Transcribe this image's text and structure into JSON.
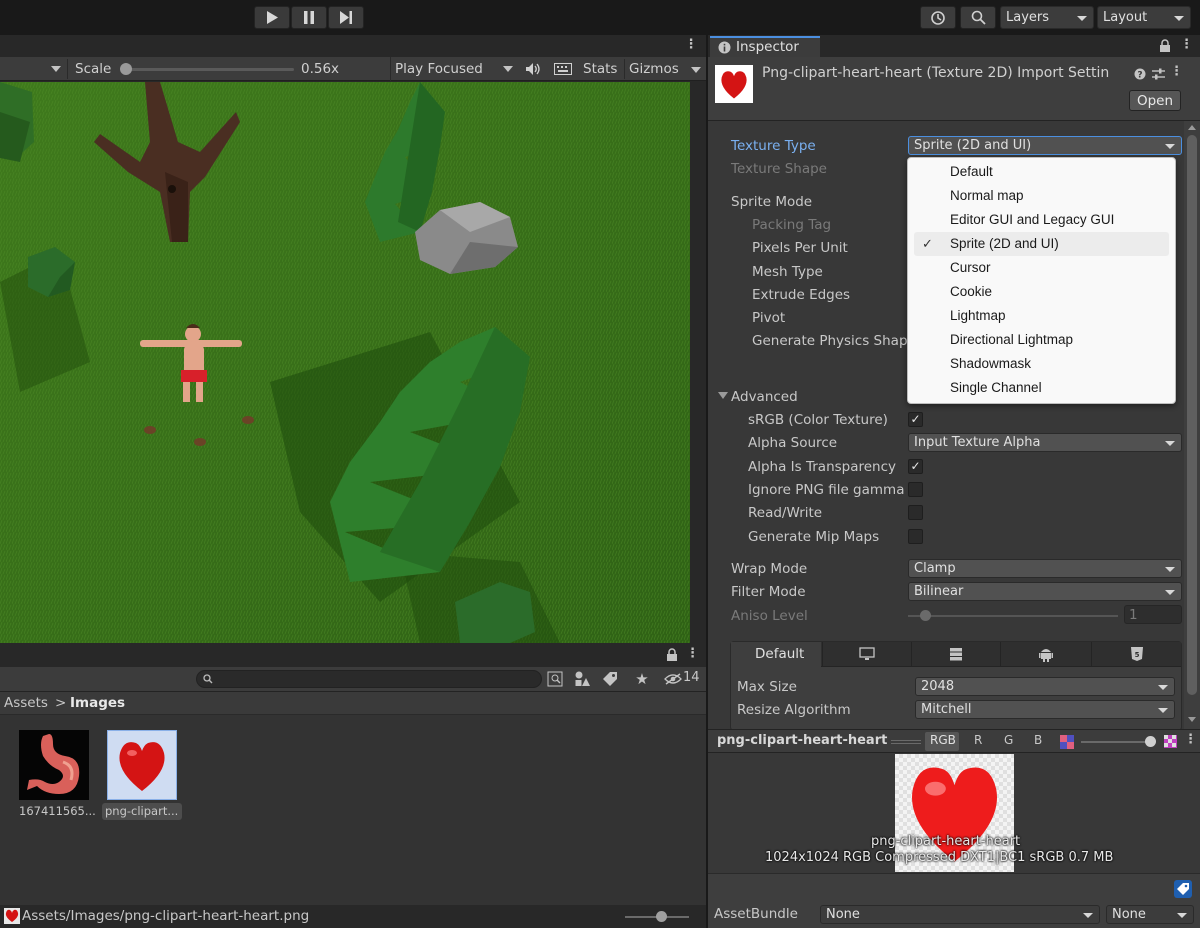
{
  "toolbar": {
    "layers_label": "Layers",
    "layout_label": "Layout"
  },
  "game_view": {
    "scale_label": "Scale",
    "scale_value": "0.56x",
    "scale_fraction": 0.0,
    "play_focused": "Play Focused",
    "stats": "Stats",
    "gizmos": "Gizmos"
  },
  "project": {
    "breadcrumb_root": "Assets",
    "breadcrumb_sep": ">",
    "breadcrumb_current": "Images",
    "hidden_count": "14",
    "assets": [
      {
        "name": "167411565...",
        "icon": "stomach-image-icon"
      },
      {
        "name": "png-clipart...",
        "icon": "heart-image-icon"
      }
    ],
    "status_path": "Assets/Images/png-clipart-heart-heart.png"
  },
  "inspector": {
    "tab_label": "Inspector",
    "title": "Png-clipart-heart-heart (Texture 2D) Import Settin",
    "open_button": "Open",
    "texture_type_label": "Texture Type",
    "texture_type_value": "Sprite (2D and UI)",
    "texture_shape_label": "Texture Shape",
    "sprite_mode_label": "Sprite Mode",
    "packing_tag_label": "Packing Tag",
    "ppu_label": "Pixels Per Unit",
    "mesh_type_label": "Mesh Type",
    "extrude_label": "Extrude Edges",
    "pivot_label": "Pivot",
    "gen_physics_label": "Generate Physics Shap",
    "advanced_label": "Advanced",
    "srgb_label": "sRGB (Color Texture)",
    "alpha_source_label": "Alpha Source",
    "alpha_source_value": "Input Texture Alpha",
    "alpha_transp_label": "Alpha Is Transparency",
    "ignore_png_label": "Ignore PNG file gamma",
    "readwrite_label": "Read/Write",
    "mipmaps_label": "Generate Mip Maps",
    "wrap_label": "Wrap Mode",
    "wrap_value": "Clamp",
    "filter_label": "Filter Mode",
    "filter_value": "Bilinear",
    "aniso_label": "Aniso Level",
    "aniso_value": "1",
    "platform_default_tab": "Default",
    "max_size_label": "Max Size",
    "max_size_value": "2048",
    "resize_label": "Resize Algorithm",
    "resize_value": "Mitchell",
    "checkboxes": {
      "srgb": true,
      "alpha_transparency": true,
      "ignore_png": false,
      "readwrite": false,
      "mipmaps": false
    }
  },
  "texture_type_menu": {
    "options": [
      "Default",
      "Normal map",
      "Editor GUI and Legacy GUI",
      "Sprite (2D and UI)",
      "Cursor",
      "Cookie",
      "Lightmap",
      "Directional Lightmap",
      "Shadowmask",
      "Single Channel"
    ],
    "selected_index": 3,
    "check_glyph": "✓"
  },
  "preview": {
    "name": "png-clipart-heart-heart",
    "channels": [
      "RGB",
      "R",
      "G",
      "B"
    ],
    "caption_name": "png-clipart-heart-heart",
    "caption_info": "1024x1024  RGB Compressed DXT1|BC1 sRGB   0.7 MB"
  },
  "asset_bundle": {
    "label": "AssetBundle",
    "name_value": "None",
    "variant_value": "None"
  },
  "colors": {
    "accent": "#7ab0f0",
    "panel": "#383838",
    "toolbar": "#282828"
  }
}
